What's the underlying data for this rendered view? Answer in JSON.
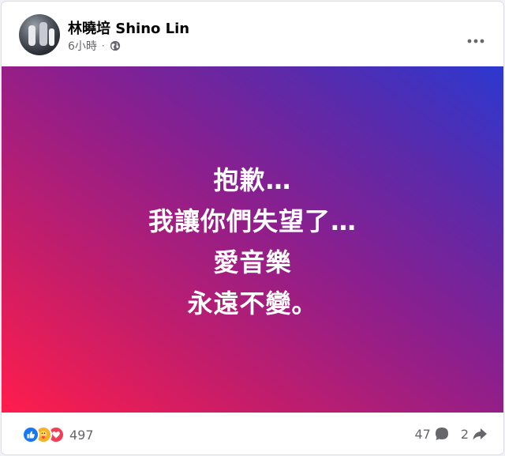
{
  "post": {
    "author_name": "林曉培 Shino Lin",
    "timestamp": "6小時",
    "separator": "·",
    "privacy_icon": "globe-icon",
    "more_icon": "more-horizontal-icon",
    "lines": [
      "抱歉…",
      "我讓你們失望了…",
      "愛音樂",
      "永遠不變。"
    ],
    "background_colors": [
      "#ff1d4b",
      "#8b1f8e",
      "#2c38d0"
    ]
  },
  "footer": {
    "reaction_icons": [
      "like-icon",
      "care-icon",
      "love-icon"
    ],
    "reaction_count": "497",
    "comment_count": "47",
    "share_count": "2"
  }
}
